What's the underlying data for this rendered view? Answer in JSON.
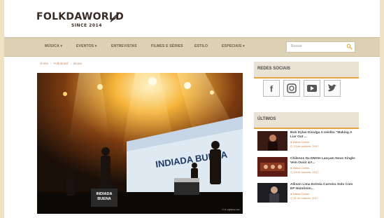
{
  "header": {
    "logo_text": "FOLKDAWORLD",
    "logo_sub": "SINCE 2014"
  },
  "nav": {
    "items": [
      {
        "label": "MÚSICA ▾"
      },
      {
        "label": "EVENTOS ▾"
      },
      {
        "label": "ENTREVISTAS"
      },
      {
        "label": "FILMES E SÉRIES"
      },
      {
        "label": "ESTILO"
      },
      {
        "label": "ESPECIAIS ▾"
      }
    ],
    "search_placeholder": "Buscar"
  },
  "breadcrumb": {
    "home": "Home",
    "section": "Folk Brasil",
    "current": "Bruxa"
  },
  "hero": {
    "banner_text": "INDIADA BUENA",
    "drum_text_1": "INDIADA",
    "drum_text_2": "BUENA",
    "credit": "© R. sightliner.com"
  },
  "sidebar": {
    "social_title": "REDES SOCIAIS",
    "social_icons": [
      "facebook-icon",
      "instagram-icon",
      "youtube-icon",
      "twitter-icon"
    ],
    "latest_title": "ÚLTIMOS",
    "posts": [
      {
        "title": "Bob Dylan Divulga A Inédita “Making A Liar Out ...",
        "author": "Maísa Carlos",
        "date": "13 de outubro, 2017"
      },
      {
        "title": "Chilenos Da DMAH Lançam Novo Single: Vem Ouvir &#...",
        "author": "Maísa Carlos",
        "date": "13 de outubro, 2017"
      },
      {
        "title": "Allison Lima Estreia Carreira Solo Com EP Homônim...",
        "author": "Maísa Carlos",
        "date": "11 de outubro, 2017"
      }
    ]
  },
  "colors": {
    "accent": "#e0a53b",
    "nav_bg": "#ddd1b5",
    "page_bg": "#efe3c4"
  }
}
